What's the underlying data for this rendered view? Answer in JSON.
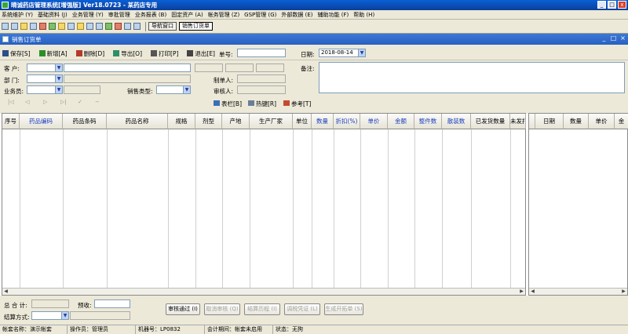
{
  "window": {
    "title": "晴诚药店管理系统[增强版]  Ver18.0723  -  某药店专用",
    "close": "x",
    "min": "_",
    "max": "□"
  },
  "menu": [
    "系统维护 (Y)",
    "基础资料 (J)",
    "业务管理 (Y)",
    "审批管理",
    "业务报表 (B)",
    "固定资产 (A)",
    "帐务管理 (Z)",
    "GSP管理 (G)",
    "外部数据 (E)",
    "辅助功能 (F)",
    "帮助 (H)"
  ],
  "toolbar": {
    "nav_button": "导航窗口",
    "tab_button": "销售订货单"
  },
  "child": {
    "title": "销售订货单"
  },
  "actions": {
    "save": "保存[S]",
    "add": "新增[A]",
    "delete": "删除[D]",
    "export": "导出[O]",
    "print": "打印[P]",
    "exit": "退出[E]"
  },
  "form": {
    "doc_no_label": "单号:",
    "date_label": "日期:",
    "date_value": "2018-08-14",
    "customer_label": "客    户:",
    "dept_label": "部    门:",
    "salesman_label": "业务员:",
    "sales_type_label": "销售类型:",
    "creator_label": "制单人:",
    "reviewer_label": "审核人:",
    "remark_label": "备注:"
  },
  "grid_tools": {
    "columns": "表栏[B]",
    "hotkey": "热键[R]",
    "reference": "参考[T]"
  },
  "grid": {
    "columns": [
      "序号",
      "药品编码",
      "药品条码",
      "药品名称",
      "规格",
      "剂型",
      "产地",
      "生产厂家",
      "单位",
      "数量",
      "折扣(%)",
      "单价",
      "金额",
      "整件数",
      "散装数",
      "已发货数量",
      "未发打"
    ]
  },
  "grid2": {
    "columns": [
      "日期",
      "数量",
      "单价",
      "金"
    ]
  },
  "footer": {
    "total_label": "总  合  计:",
    "prepay_label": "预收:",
    "settle_label": "结算方式:"
  },
  "buttons": {
    "approve": "审核通过 (I)",
    "cancel_approve": "取消审核 (Q)",
    "settle_history": "结算历程 (I)",
    "adjust": "调税凭证 (L)",
    "gen_order": "生成开拓单 (S)"
  },
  "status": [
    "帐套名称：演示帐套",
    "操作员：管理员",
    "机器号：LP0832",
    "会计期间：帐套未启用",
    "状态：无狗"
  ],
  "colors": {
    "title_bar": "#0a4fb8",
    "child_title": "#3068d0",
    "header_blue": "#1c3fbe"
  }
}
